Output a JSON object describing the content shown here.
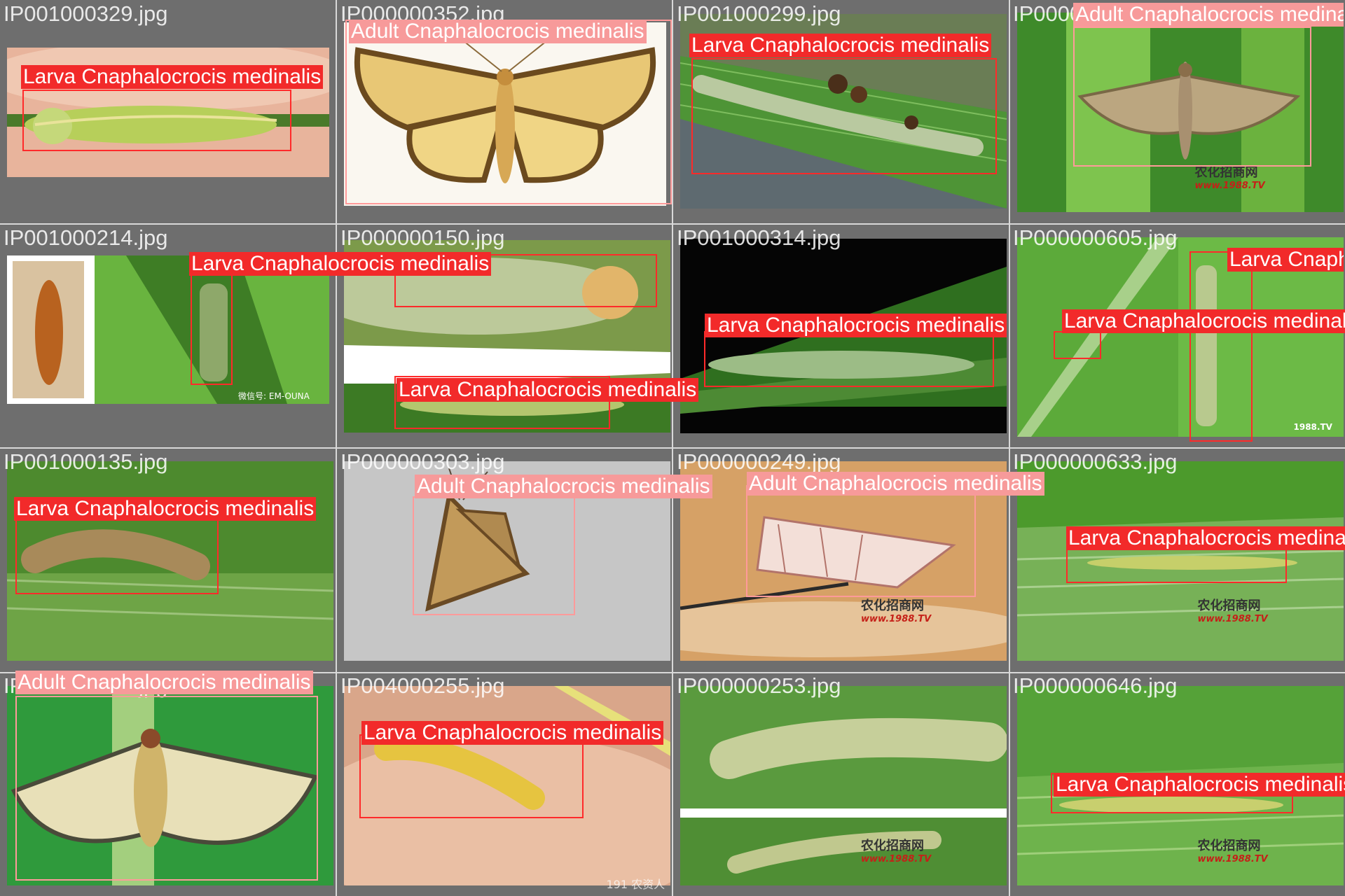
{
  "colors": {
    "larva_label": "#f22a2a",
    "adult_label": "#f79a9a",
    "cell_background": "#6e6e6e"
  },
  "tiles": [
    {
      "filename": "IP001000329.jpg",
      "labels": [
        {
          "class": "larva",
          "text": "Larva Cnaphalocrocis medinalis"
        }
      ]
    },
    {
      "filename": "IP000000352.jpg",
      "labels": [
        {
          "class": "adult",
          "text": "Adult Cnaphalocrocis medinalis"
        }
      ]
    },
    {
      "filename": "IP001000299.jpg",
      "labels": [
        {
          "class": "larva",
          "text": "Larva Cnaphalocrocis medinalis"
        }
      ]
    },
    {
      "filename": "IP000000298.jpg",
      "labels": [
        {
          "class": "adult",
          "text": "Adult Cnaphalocrocis medinalis"
        }
      ],
      "watermark": {
        "cn": "农化招商网",
        "url": "www.1988.TV"
      }
    },
    {
      "filename": "IP001000214.jpg",
      "labels": [
        {
          "class": "larva",
          "text": "Larva Cnaphalocrocis medinalis"
        }
      ],
      "watermark2": "微信号: EM-OUNA"
    },
    {
      "filename": "IP000000150.jpg",
      "labels": [
        {
          "class": "larva",
          "text": "Larva Cnaphalocrocis medinalis"
        },
        {
          "class": "larva",
          "text": "Larva Cnaphalocrocis medinalis"
        }
      ]
    },
    {
      "filename": "IP001000314.jpg",
      "labels": [
        {
          "class": "larva",
          "text": "Larva Cnaphalocrocis medinalis"
        }
      ]
    },
    {
      "filename": "IP000000605.jpg",
      "labels": [
        {
          "class": "larva",
          "text": "Larva Cnaphalocrocis medinalis"
        },
        {
          "class": "larva",
          "text": "Larva Cnaphalocrocis medinalis"
        }
      ],
      "watermark2": "1988.TV"
    },
    {
      "filename": "IP001000135.jpg",
      "labels": [
        {
          "class": "larva",
          "text": "Larva Cnaphalocrocis medinalis"
        }
      ]
    },
    {
      "filename": "IP000000303.jpg",
      "labels": [
        {
          "class": "adult",
          "text": "Adult Cnaphalocrocis medinalis"
        }
      ]
    },
    {
      "filename": "IP000000249.jpg",
      "labels": [
        {
          "class": "adult",
          "text": "Adult Cnaphalocrocis medinalis"
        }
      ],
      "watermark": {
        "cn": "农化招商网",
        "url": "www.1988.TV"
      }
    },
    {
      "filename": "IP000000633.jpg",
      "labels": [
        {
          "class": "larva",
          "text": "Larva Cnaphalocrocis medinalis"
        }
      ],
      "watermark": {
        "cn": "农化招商网",
        "url": "www.1988.TV"
      }
    },
    {
      "filename": "IP000000277.jpg",
      "labels": [
        {
          "class": "adult",
          "text": "Adult Cnaphalocrocis medinalis"
        }
      ]
    },
    {
      "filename": "IP004000255.jpg",
      "labels": [
        {
          "class": "larva",
          "text": "Larva Cnaphalocrocis medinalis"
        }
      ],
      "watermark2": "191 农资人"
    },
    {
      "filename": "IP000000253.jpg",
      "labels": [],
      "watermark": {
        "cn": "农化招商网",
        "url": "www.1988.TV"
      }
    },
    {
      "filename": "IP000000646.jpg",
      "labels": [
        {
          "class": "larva",
          "text": "Larva Cnaphalocrocis medinalis"
        }
      ],
      "watermark": {
        "cn": "农化招商网",
        "url": "www.1988.TV"
      }
    }
  ]
}
